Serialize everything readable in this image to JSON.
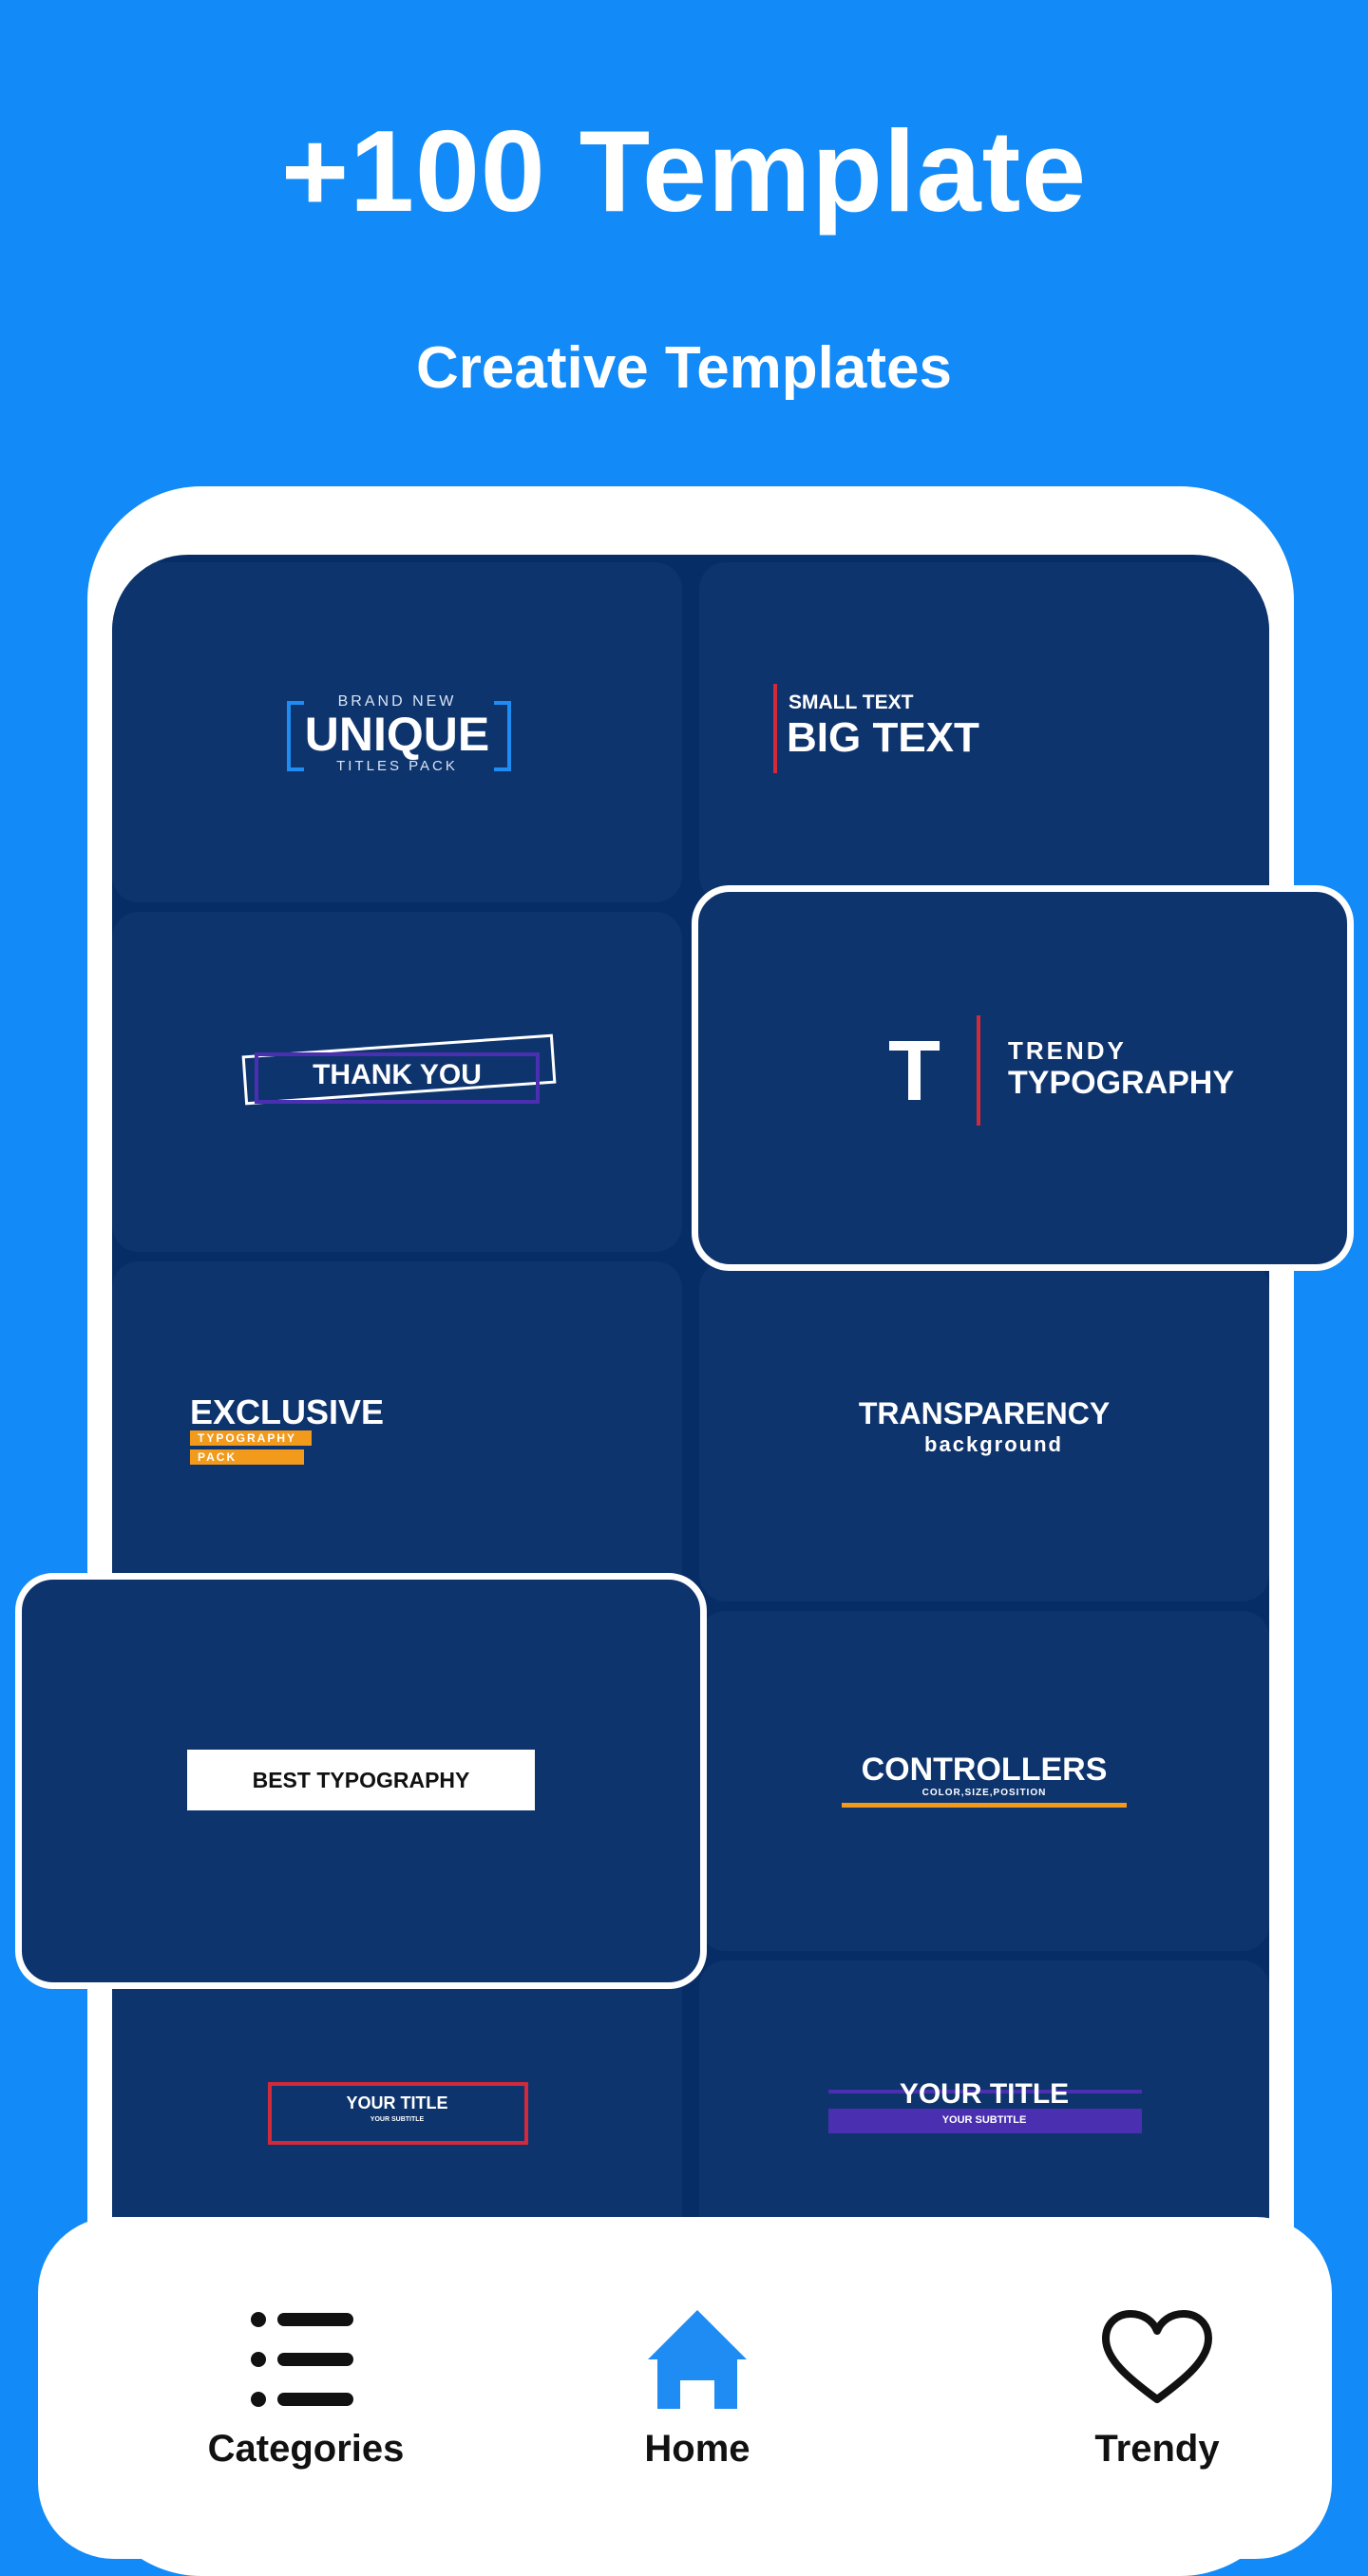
{
  "header": {
    "title": "+100 Template",
    "subtitle": "Creative Templates"
  },
  "templates": {
    "unique": {
      "top": "BRAND NEW",
      "main": "UNIQUE",
      "bottom": "TITLES PACK"
    },
    "big_text": {
      "small": "SMALL TEXT",
      "big": "BIG TEXT"
    },
    "thank_you": {
      "label": "THANK YOU"
    },
    "trendy": {
      "letter": "T",
      "line1": "TRENDY",
      "line2": "TYPOGRAPHY"
    },
    "exclusive": {
      "main": "EXCLUSIVE",
      "tag1": "TYPOGRAPHY",
      "tag2": "PACK"
    },
    "transparency": {
      "main": "TRANSPARENCY",
      "sub": "background"
    },
    "best": {
      "label": "BEST TYPOGRAPHY"
    },
    "controllers": {
      "main": "CONTROLLERS",
      "sub": "COLOR,SIZE,POSITION"
    },
    "your_title_1": {
      "main": "YOUR TITLE",
      "sub": "YOUR SUBTITLE"
    },
    "your_title_2": {
      "main": "YOUR TITLE",
      "sub": "YOUR SUBTITLE"
    }
  },
  "nav": {
    "items": [
      {
        "label": "Categories",
        "icon": "list-icon"
      },
      {
        "label": "Home",
        "icon": "home-icon",
        "active": true
      },
      {
        "label": "Trendy",
        "icon": "heart-icon"
      }
    ]
  },
  "colors": {
    "background": "#128AF7",
    "screen": "#072D66",
    "card": "#0E346E",
    "accent_blue": "#1E8CF2",
    "accent_red": "#D12A3A",
    "accent_orange": "#F29A1C",
    "accent_purple": "#4A2FB0"
  }
}
